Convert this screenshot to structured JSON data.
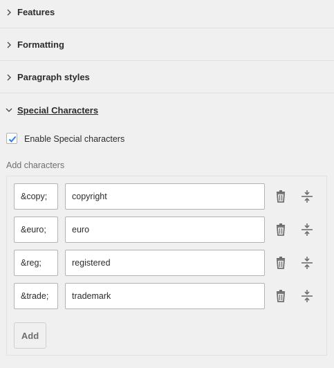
{
  "sections": {
    "features": {
      "label": "Features"
    },
    "formatting": {
      "label": "Formatting"
    },
    "paragraph_styles": {
      "label": "Paragraph styles"
    },
    "special_characters": {
      "label": "Special Characters"
    }
  },
  "enable_special": {
    "label": "Enable Special characters",
    "checked": true
  },
  "add_characters": {
    "label": "Add characters"
  },
  "characters": [
    {
      "code": "&copy;",
      "name": "copyright"
    },
    {
      "code": "&euro;",
      "name": "euro"
    },
    {
      "code": "&reg;",
      "name": "registered"
    },
    {
      "code": "&trade;",
      "name": "trademark"
    }
  ],
  "add_button": {
    "label": "Add"
  },
  "icons": {
    "collapsed": "chevron-right-icon",
    "expanded": "chevron-down-icon",
    "delete": "trash-icon",
    "reorder": "move-handle-icon",
    "check": "checkmark-icon"
  },
  "colors": {
    "accent": "#2680eb",
    "background": "#f0f0f0",
    "border": "#b3b3b3"
  }
}
